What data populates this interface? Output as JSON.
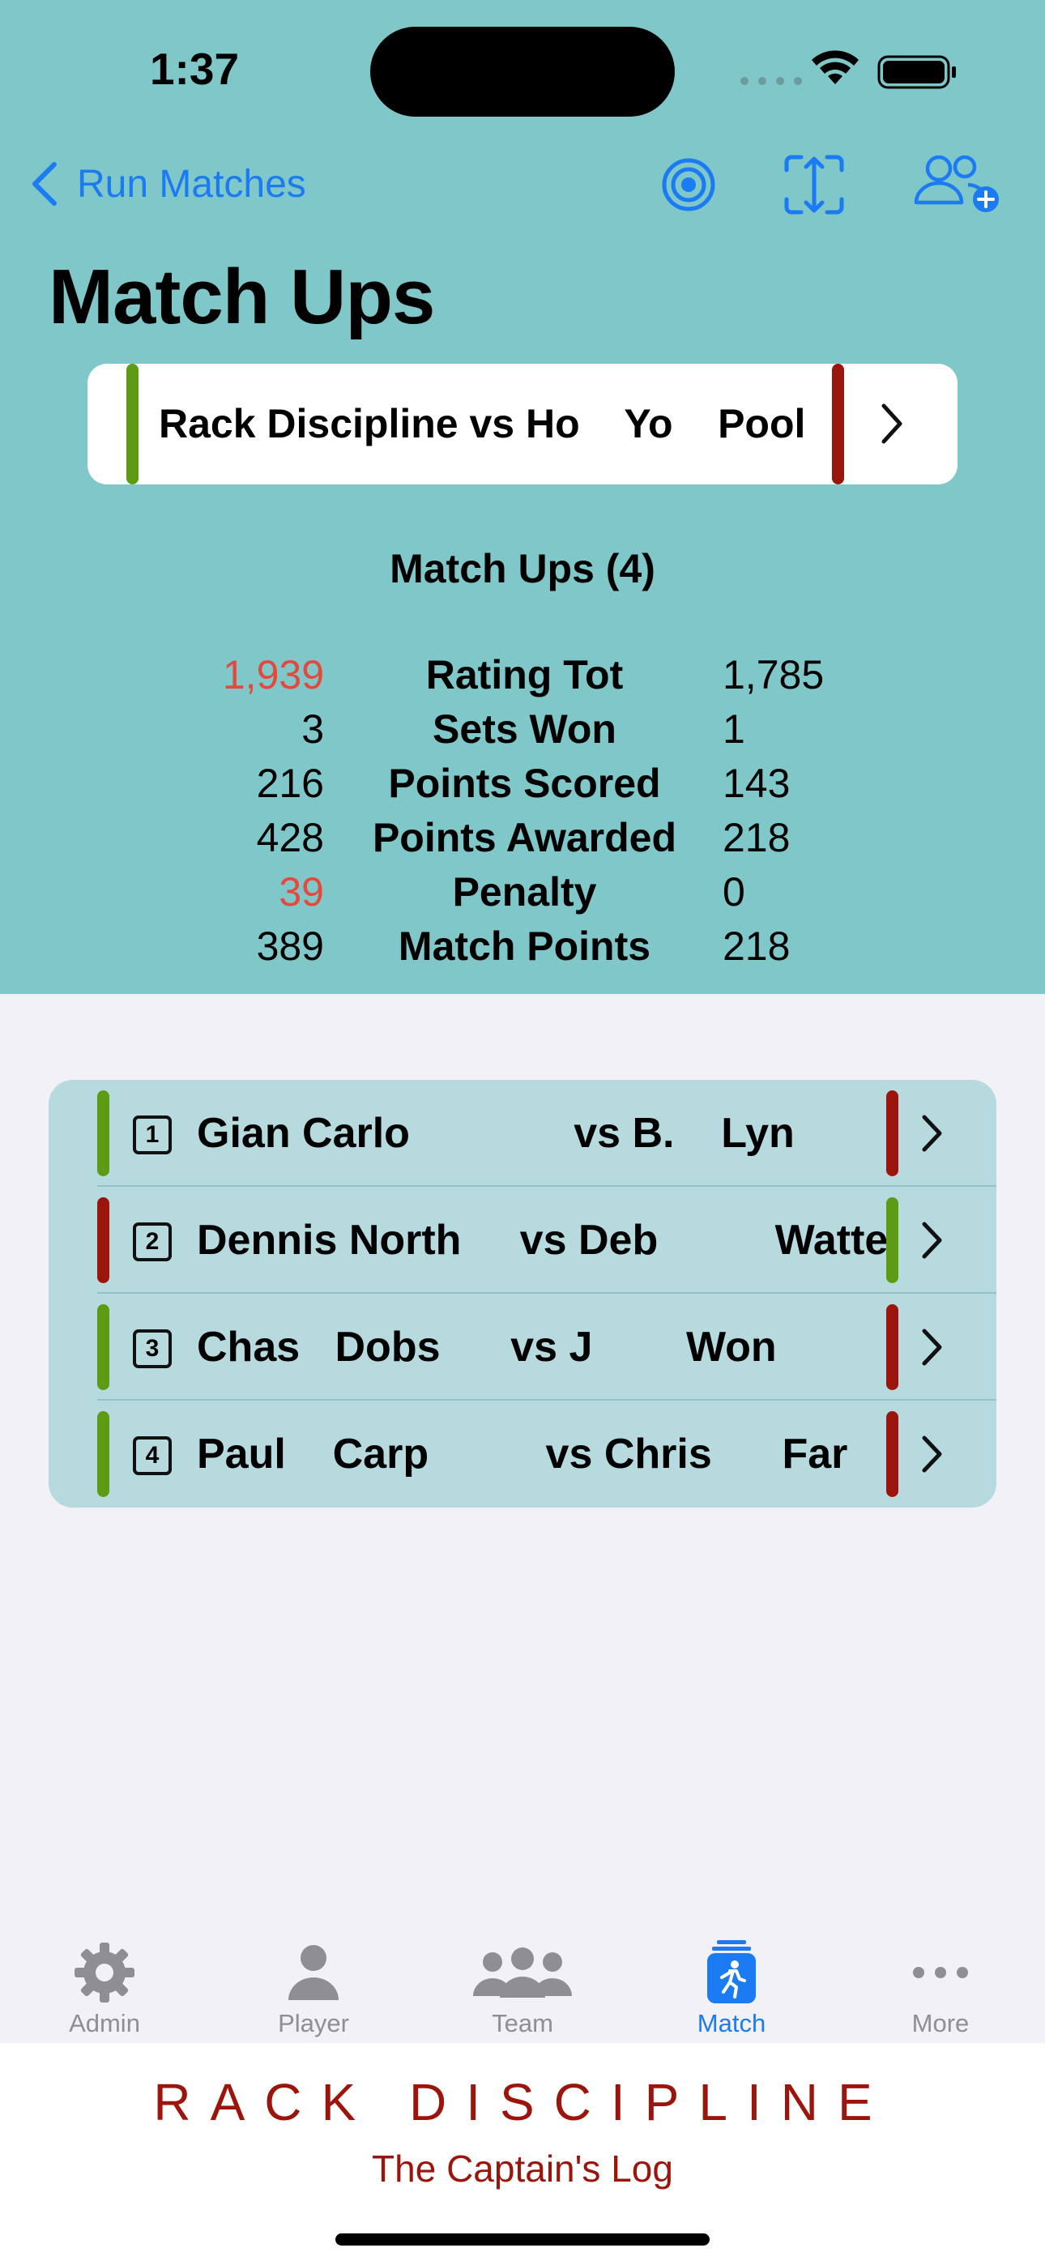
{
  "status_bar": {
    "time": "1:37"
  },
  "nav": {
    "back_label": "Run Matches"
  },
  "page_title": "Match Ups",
  "match_card": {
    "title": "Rack Discipline vs Ho    Yo    Pool"
  },
  "summary": {
    "title": "Match Ups (4)",
    "rows": [
      {
        "left": "1,939",
        "label": "Rating Tot",
        "right": "1,785",
        "left_highlight": true
      },
      {
        "left": "3",
        "label": "Sets Won",
        "right": "1",
        "left_highlight": false
      },
      {
        "left": "216",
        "label": "Points Scored",
        "right": "143",
        "left_highlight": false
      },
      {
        "left": "428",
        "label": "Points Awarded",
        "right": "218",
        "left_highlight": false
      },
      {
        "left": "39",
        "label": "Penalty",
        "right": "0",
        "left_highlight": true
      },
      {
        "left": "389",
        "label": "Match Points",
        "right": "218",
        "left_highlight": false
      }
    ]
  },
  "matchups": [
    {
      "number": "1",
      "text": "Gian Carlo              vs B.    Lyn",
      "left_color": "green",
      "right_color": "red"
    },
    {
      "number": "2",
      "text": "Dennis North     vs Deb          Watte",
      "left_color": "red",
      "right_color": "green"
    },
    {
      "number": "3",
      "text": "Chas   Dobs      vs J        Won",
      "left_color": "green",
      "right_color": "red"
    },
    {
      "number": "4",
      "text": "Paul    Carp          vs Chris      Far",
      "left_color": "green",
      "right_color": "red"
    }
  ],
  "tabs": [
    {
      "label": "Admin",
      "icon": "gear-icon",
      "active": false
    },
    {
      "label": "Player",
      "icon": "person-icon",
      "active": false
    },
    {
      "label": "Team",
      "icon": "team-icon",
      "active": false
    },
    {
      "label": "Match",
      "icon": "match-icon",
      "active": true
    },
    {
      "label": "More",
      "icon": "ellipsis-icon",
      "active": false
    }
  ],
  "footer": {
    "brand": "RACK DISCIPLINE",
    "tagline": "The Captain's Log"
  },
  "colors": {
    "header_bg": "#7FC7C8",
    "accent": "#1A7BF2",
    "green": "#5E9B14",
    "red": "#9C150D",
    "highlight": "#E4493D",
    "list_bg": "#B6DADE"
  }
}
